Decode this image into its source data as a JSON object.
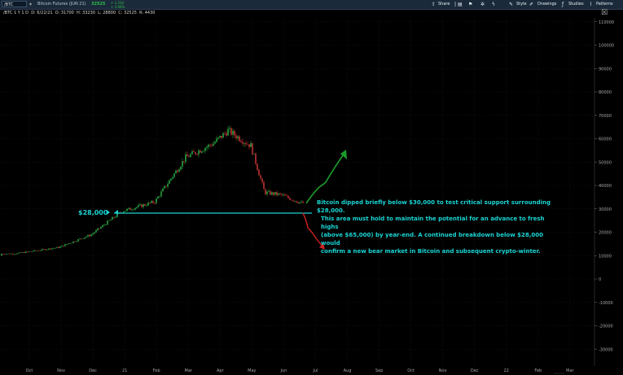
{
  "toolbar": {
    "symbol": "/BTC",
    "description": "Bitcoin Futures (JUN 21)",
    "price": "32525",
    "change_top": "+ 1.234",
    "change_bottom": "+ 3.94%",
    "share_label": "Share",
    "style_label": "Style",
    "drawings_label": "Drawings",
    "studies_label": "Studies",
    "patterns_label": "Patterns",
    "colors": {
      "bg": "#1b2a3a",
      "price_up": "#2ec04a"
    }
  },
  "info_bar": {
    "timeframe": "/BTC 1 Y 1 D",
    "date": "D: 6/22/21",
    "open": "O: 31700",
    "high": "H: 33230",
    "low": "L: 28800",
    "close": "C: 32525",
    "range": "R: 4430"
  },
  "chart_data": {
    "type": "candlestick",
    "title": "",
    "xlabel": "",
    "ylabel": "",
    "x_ticks": [
      "Oct",
      "Nov",
      "Dec",
      "21",
      "Feb",
      "Mar",
      "Apr",
      "May",
      "Jun",
      "Jul",
      "Aug",
      "Sep",
      "Oct",
      "Nov",
      "Dec",
      "22",
      "Feb",
      "Mar"
    ],
    "y_ticks": [
      110000,
      100000,
      90000,
      80000,
      70000,
      60000,
      50000,
      40000,
      30000,
      20000,
      10000,
      0,
      -10000,
      -20000,
      -30000
    ],
    "ylim": [
      -35000,
      115000
    ],
    "grid": true,
    "approx_close_path": [
      {
        "month": "Oct",
        "close": 10800
      },
      {
        "month": "Nov",
        "close": 13500
      },
      {
        "month": "Dec",
        "close": 19000
      },
      {
        "month": "21",
        "close": 29000
      },
      {
        "month": "Feb",
        "close": 33000
      },
      {
        "month": "Mar",
        "close": 52000
      },
      {
        "month": "Apr",
        "close": 58000
      },
      {
        "month": "Apr-mid",
        "close": 63500
      },
      {
        "month": "May",
        "close": 57000
      },
      {
        "month": "May-late",
        "close": 37000
      },
      {
        "month": "Jun",
        "close": 36000
      },
      {
        "month": "Jun-late",
        "close": 32525
      }
    ],
    "support_level": {
      "label": "$28,000",
      "value": 28000
    },
    "scenario_arrows": [
      {
        "name": "bullish",
        "color": "#1c9b2a",
        "target": 55000
      },
      {
        "name": "bearish",
        "color": "#d02020",
        "target": 14000
      }
    ]
  },
  "annotation": {
    "lines": [
      "Bitcoin dipped briefly below $30,000 to test critical support surrounding $28,000.",
      "This area must hold to maintain the potential for an advance to fresh highs",
      "(above $65,000) by year-end. A continued breakdown below $28,000 would",
      "confirm a new bear market in Bitcoin and subsequent crypto-winter."
    ],
    "color": "#19d4d4"
  }
}
